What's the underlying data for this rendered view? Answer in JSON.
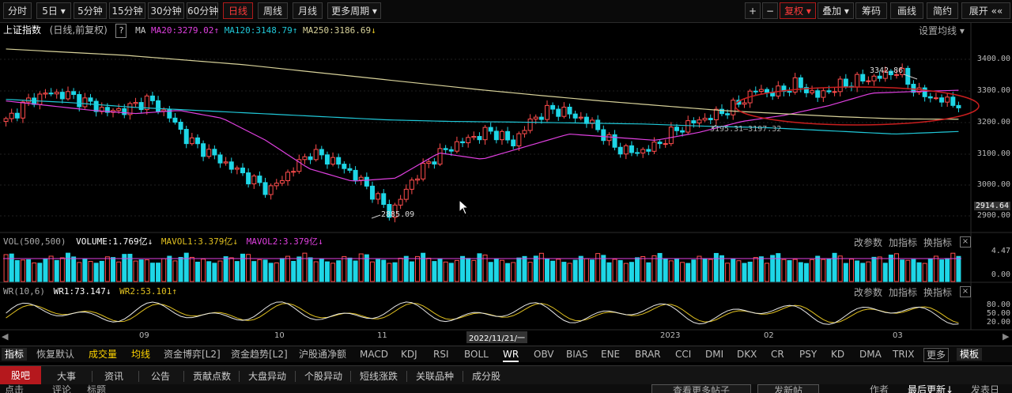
{
  "toolbar": {
    "periods": [
      "分时",
      "5日",
      "5分钟",
      "15分钟",
      "30分钟",
      "60分钟",
      "日线",
      "周线",
      "月线",
      "更多周期"
    ],
    "active_period": "日线",
    "right_buttons": [
      "+",
      "−",
      "复权",
      "叠加",
      "筹码",
      "画线",
      "简约",
      "展开"
    ],
    "right_arrows": "««"
  },
  "main_info": {
    "title": "上证指数",
    "subtitle": "(日线,前复权)",
    "help": "?",
    "ma_label": "MA",
    "ma20": "MA20:3279.02",
    "ma120": "MA120:3148.79",
    "ma250": "MA250:3186.69",
    "settings": "设置均线"
  },
  "annotations": {
    "high": "3342.86",
    "low": "2885.09",
    "level": "3195.31—3197.32"
  },
  "price_axis": [
    "3400.00",
    "3300.00",
    "3200.00",
    "3100.00",
    "3000.00",
    "2914.64",
    "2900.00"
  ],
  "vol_info": {
    "name": "VOL(500,500)",
    "volume": "VOLUME:1.769亿",
    "mavol1": "MAVOL1:3.379亿",
    "mavol2": "MAVOL2:3.379亿",
    "axis": [
      "4.47",
      "0.00"
    ]
  },
  "wr_info": {
    "name": "WR(10,6)",
    "wr1": "WR1:73.147",
    "wr2": "WR2:53.101",
    "axis": [
      "80.00",
      "50.00",
      "20.00"
    ]
  },
  "panel_buttons": [
    "改参数",
    "加指标",
    "换指标",
    "×"
  ],
  "x_axis": [
    "09",
    "10",
    "11",
    "2022/11/21/一",
    "2023",
    "02",
    "03"
  ],
  "indicators": [
    "指标",
    "恢复默认",
    "成交量",
    "均线",
    "资金博弈[L2]",
    "资金趋势[L2]",
    "沪股通净额",
    "MACD",
    "KDJ",
    "RSI",
    "BOLL",
    "WR",
    "OBV",
    "BIAS",
    "ENE",
    "BRAR",
    "CCI",
    "DMI",
    "DKX",
    "CR",
    "PSY",
    "KD",
    "DMA",
    "TRIX",
    "更多",
    "模板"
  ],
  "tabs": [
    "股吧",
    "大事",
    "资讯",
    "公告",
    "贡献点数",
    "大盘异动",
    "个股异动",
    "短线涨跌",
    "关联品种",
    "成分股"
  ],
  "subtabs": [
    "点击",
    "评论",
    "标题",
    "查看更多帖子",
    "发新帖",
    "作者",
    "最后更新↓",
    "发表日"
  ],
  "colors": {
    "up": "#ff4d4d",
    "down": "#1ed6e6",
    "ma20": "#e040e0",
    "ma120": "#20c8d8",
    "ma250": "#d8d29a",
    "ellipse": "#c81e1e",
    "wr1": "#e8e8e8",
    "wr2": "#e0c020"
  },
  "chart_data": [
    {
      "type": "line",
      "title": "上证指数 (日线,前复权)",
      "x_ticks": [
        "09",
        "10",
        "11",
        "2023",
        "02",
        "03"
      ],
      "ylim": [
        2850,
        3440
      ],
      "series": [
        {
          "name": "MA20",
          "values": [
            3245,
            3230,
            3215,
            3205,
            3215,
            3190,
            3120,
            3030,
            2990,
            3000,
            3080,
            3060,
            3100,
            3140,
            3130,
            3120,
            3145,
            3180,
            3200,
            3230,
            3270,
            3275,
            3279
          ]
        },
        {
          "name": "MA120",
          "values": [
            3250,
            3240,
            3225,
            3215,
            3205,
            3195,
            3185,
            3180,
            3178,
            3175,
            3172,
            3165,
            3160,
            3150,
            3140,
            3148
          ]
        },
        {
          "name": "MA250",
          "values": [
            3410,
            3400,
            3390,
            3375,
            3360,
            3340,
            3320,
            3300,
            3280,
            3262,
            3245,
            3230,
            3215,
            3205,
            3195,
            3188,
            3187
          ]
        }
      ],
      "close_values": [
        3180,
        3240,
        3270,
        3265,
        3240,
        3210,
        3220,
        3250,
        3200,
        3120,
        3080,
        3040,
        3000,
        2960,
        3020,
        3080,
        3060,
        3020,
        2960,
        2885,
        2990,
        3060,
        3100,
        3130,
        3150,
        3110,
        3190,
        3220,
        3200,
        3170,
        3100,
        3080,
        3100,
        3150,
        3180,
        3200,
        3230,
        3280,
        3270,
        3300,
        3260,
        3290,
        3310,
        3320,
        3342,
        3270,
        3250,
        3235
      ]
    },
    {
      "type": "bar",
      "title": "VOL(500,500)",
      "ylim": [
        0,
        4.47
      ]
    },
    {
      "type": "line",
      "title": "WR(10,6)",
      "ylim": [
        0,
        100
      ],
      "series": [
        {
          "name": "WR1",
          "last": 73.147
        },
        {
          "name": "WR2",
          "last": 53.101
        }
      ]
    }
  ]
}
